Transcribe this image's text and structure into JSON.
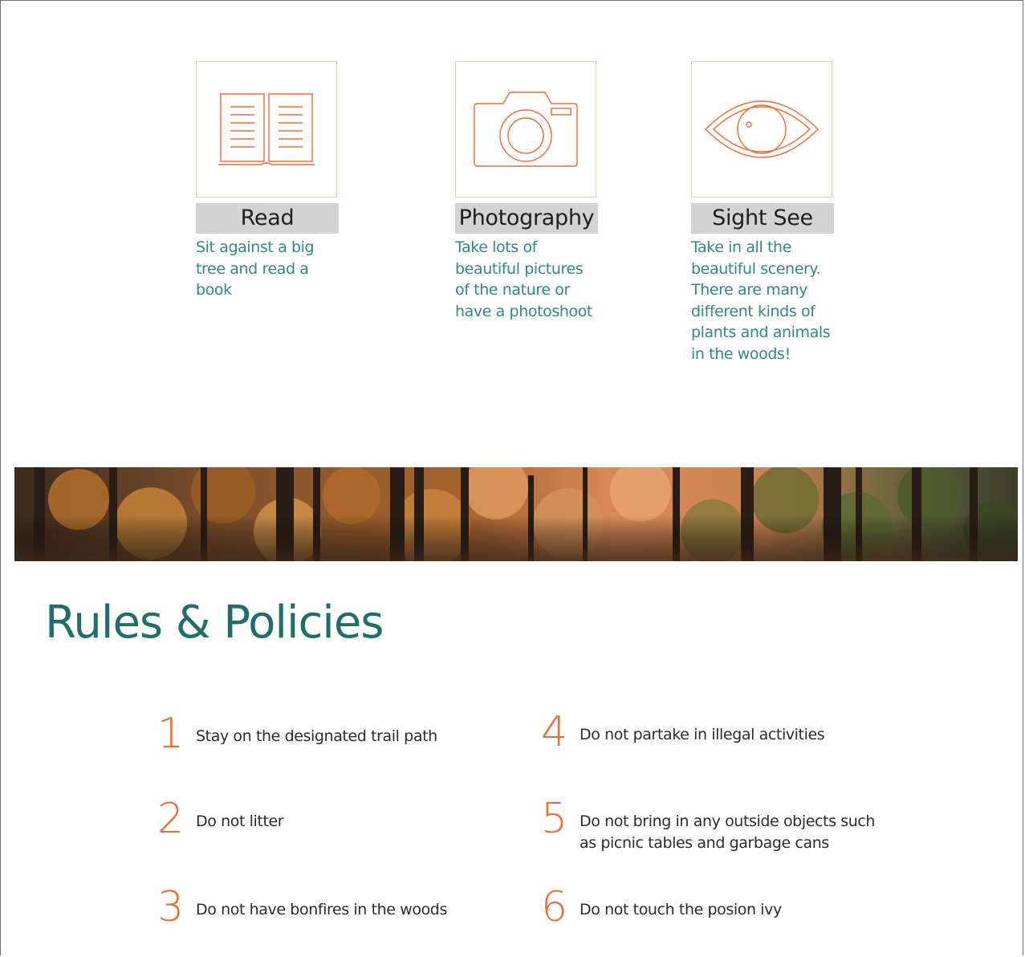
{
  "activities": [
    {
      "label": "Read",
      "icon": "open-book-icon",
      "description": "Sit against a big tree and read a book"
    },
    {
      "label": "Photography",
      "icon": "camera-icon",
      "description": "Take lots of beautiful pictures of the nature or have a photoshoot"
    },
    {
      "label": "Sight See",
      "icon": "eye-icon",
      "description": "Take in all the beautiful scenery. There are many different kinds of plants and animals in the woods!"
    }
  ],
  "rules_section": {
    "title": "Rules & Policies",
    "rules": [
      {
        "number": "1",
        "text": "Stay on the designated trail path"
      },
      {
        "number": "2",
        "text": "Do not litter"
      },
      {
        "number": "3",
        "text": "Do not have bonfires in the woods"
      },
      {
        "number": "4",
        "text": "Do not partake in illegal activities"
      },
      {
        "number": "5",
        "text": "Do not bring in any outside objects such as picnic tables and garbage cans"
      },
      {
        "number": "6",
        "text": "Do not touch the posion ivy"
      }
    ]
  },
  "colors": {
    "accent_orange": "#f26a33",
    "teal_text": "#2d8a80",
    "heading_teal": "#1f6f69",
    "label_bg": "#d3d3d3"
  }
}
